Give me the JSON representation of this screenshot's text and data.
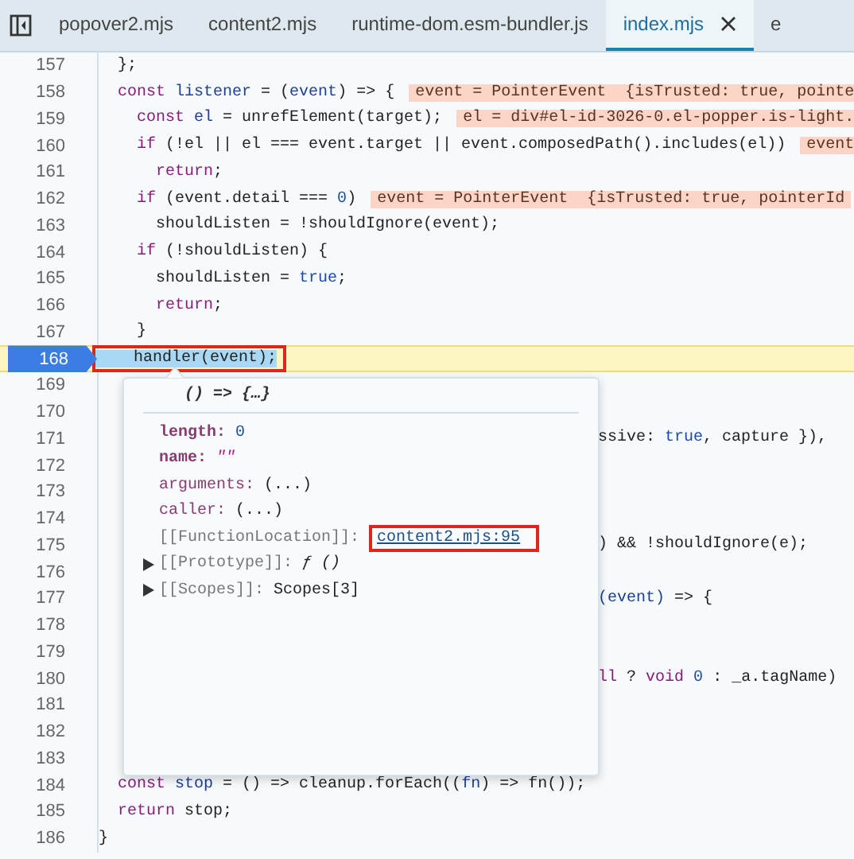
{
  "tabs": [
    {
      "label": "popover2.mjs",
      "selected": false,
      "closable": false
    },
    {
      "label": "content2.mjs",
      "selected": false,
      "closable": false
    },
    {
      "label": "runtime-dom.esm-bundler.js",
      "selected": false,
      "closable": false
    },
    {
      "label": "index.mjs",
      "selected": true,
      "closable": true
    },
    {
      "label": "e",
      "selected": false,
      "closable": false
    }
  ],
  "lines": [
    {
      "number": "157",
      "current": false,
      "marked": false,
      "tokens": [
        {
          "kind": "plain",
          "text": "  };"
        }
      ]
    },
    {
      "number": "158",
      "current": false,
      "marked": false,
      "tokens": [
        {
          "kind": "keyword",
          "text": "  const "
        },
        {
          "kind": "name",
          "text": "listener"
        },
        {
          "kind": "plain",
          "text": " = ("
        },
        {
          "kind": "name",
          "text": "event"
        },
        {
          "kind": "plain",
          "text": ") => {"
        }
      ],
      "inline_value": "event = PointerEvent  {isTrusted: true, pointe"
    },
    {
      "number": "159",
      "current": false,
      "marked": false,
      "tokens": [
        {
          "kind": "keyword",
          "text": "    const "
        },
        {
          "kind": "name",
          "text": "el"
        },
        {
          "kind": "plain",
          "text": " = unrefElement(target);"
        }
      ],
      "inline_value": "el = div#el-id-3026-0.el-popper.is-light."
    },
    {
      "number": "160",
      "current": false,
      "marked": false,
      "tokens": [
        {
          "kind": "keyword",
          "text": "    if"
        },
        {
          "kind": "plain",
          "text": " (!el || el === event.target || event.composedPath().includes(el))"
        }
      ],
      "inline_value": "event"
    },
    {
      "number": "161",
      "current": false,
      "marked": false,
      "tokens": [
        {
          "kind": "keyword",
          "text": "      return"
        },
        {
          "kind": "plain",
          "text": ";"
        }
      ]
    },
    {
      "number": "162",
      "current": false,
      "marked": false,
      "tokens": [
        {
          "kind": "keyword",
          "text": "    if"
        },
        {
          "kind": "plain",
          "text": " (event.detail === "
        },
        {
          "kind": "literal",
          "text": "0"
        },
        {
          "kind": "plain",
          "text": ")"
        }
      ],
      "inline_value": "event = PointerEvent  {isTrusted: true, pointerId"
    },
    {
      "number": "163",
      "current": false,
      "marked": false,
      "tokens": [
        {
          "kind": "plain",
          "text": "      shouldListen = !shouldIgnore(event);"
        }
      ]
    },
    {
      "number": "164",
      "current": false,
      "marked": false,
      "tokens": [
        {
          "kind": "keyword",
          "text": "    if"
        },
        {
          "kind": "plain",
          "text": " (!shouldListen) {"
        }
      ]
    },
    {
      "number": "165",
      "current": false,
      "marked": false,
      "tokens": [
        {
          "kind": "plain",
          "text": "      shouldListen = "
        },
        {
          "kind": "literal",
          "text": "true"
        },
        {
          "kind": "plain",
          "text": ";"
        }
      ]
    },
    {
      "number": "166",
      "current": false,
      "marked": false,
      "tokens": [
        {
          "kind": "keyword",
          "text": "      return"
        },
        {
          "kind": "plain",
          "text": ";"
        }
      ]
    },
    {
      "number": "167",
      "current": false,
      "marked": false,
      "tokens": [
        {
          "kind": "plain",
          "text": "    }"
        }
      ]
    },
    {
      "number": "168",
      "current": true,
      "marked": true,
      "tokens": [
        {
          "kind": "plain",
          "text": "    handler(event);"
        }
      ]
    },
    {
      "number": "169",
      "current": false,
      "marked": false
    },
    {
      "number": "170",
      "current": false,
      "marked": false
    },
    {
      "number": "171",
      "current": false,
      "marked": false,
      "tail": [
        {
          "kind": "plain",
          "text": "ssive: "
        },
        {
          "kind": "literal",
          "text": "true"
        },
        {
          "kind": "plain",
          "text": ", capture }),"
        }
      ]
    },
    {
      "number": "172",
      "current": false,
      "marked": false
    },
    {
      "number": "173",
      "current": false,
      "marked": false
    },
    {
      "number": "174",
      "current": false,
      "marked": false
    },
    {
      "number": "175",
      "current": false,
      "marked": false,
      "tail": [
        {
          "kind": "plain",
          "text": ") && !shouldIgnore(e);"
        }
      ]
    },
    {
      "number": "176",
      "current": false,
      "marked": false
    },
    {
      "number": "177",
      "current": false,
      "marked": false,
      "tail": [
        {
          "kind": "name",
          "text": "(event)"
        },
        {
          "kind": "plain",
          "text": " => {"
        }
      ]
    },
    {
      "number": "178",
      "current": false,
      "marked": false
    },
    {
      "number": "179",
      "current": false,
      "marked": false
    },
    {
      "number": "180",
      "current": false,
      "marked": false,
      "tail": [
        {
          "kind": "keyword",
          "text": "ll"
        },
        {
          "kind": "plain",
          "text": " ? "
        },
        {
          "kind": "keyword",
          "text": "void"
        },
        {
          "kind": "literal",
          "text": " 0"
        },
        {
          "kind": "plain",
          "text": " : _a.tagName)"
        }
      ]
    },
    {
      "number": "181",
      "current": false,
      "marked": false
    },
    {
      "number": "182",
      "current": false,
      "marked": false
    },
    {
      "number": "183",
      "current": false,
      "marked": false
    },
    {
      "number": "184",
      "current": false,
      "marked": false,
      "tokens": [
        {
          "kind": "keyword",
          "text": "  const "
        },
        {
          "kind": "name",
          "text": "stop"
        },
        {
          "kind": "plain",
          "text": " = () => cleanup.forEach(("
        },
        {
          "kind": "name",
          "text": "fn"
        },
        {
          "kind": "plain",
          "text": ") => fn());"
        }
      ]
    },
    {
      "number": "185",
      "current": false,
      "marked": false,
      "tokens": [
        {
          "kind": "keyword",
          "text": "  return"
        },
        {
          "kind": "plain",
          "text": " stop;"
        }
      ]
    },
    {
      "number": "186",
      "current": false,
      "marked": false,
      "tokens": [
        {
          "kind": "plain",
          "text": "}"
        }
      ]
    }
  ],
  "popover": {
    "title": "() => {…}",
    "properties": [
      {
        "name": {
          "kind": "own",
          "text": "length:"
        },
        "value": {
          "kind": "number",
          "text": "0"
        },
        "expandable": false,
        "marked": false
      },
      {
        "name": {
          "kind": "own",
          "text": "name:"
        },
        "value": {
          "kind": "string",
          "text": "\"\""
        },
        "expandable": false,
        "marked": false
      },
      {
        "name": {
          "kind": "accessor",
          "text": "arguments:"
        },
        "value": {
          "kind": "plain",
          "text": "(...)"
        },
        "expandable": false,
        "marked": false
      },
      {
        "name": {
          "kind": "accessor",
          "text": "caller:"
        },
        "value": {
          "kind": "plain",
          "text": "(...)"
        },
        "expandable": false,
        "marked": false
      },
      {
        "name": {
          "kind": "internal",
          "text": "[[FunctionLocation]]:"
        },
        "value": {
          "kind": "link",
          "text": "content2.mjs:95"
        },
        "expandable": false,
        "marked": true
      },
      {
        "name": {
          "kind": "internal",
          "text": "[[Prototype]]:"
        },
        "value": {
          "kind": "function",
          "text": "ƒ ()"
        },
        "expandable": true,
        "marked": false
      },
      {
        "name": {
          "kind": "internal",
          "text": "[[Scopes]]:"
        },
        "value": {
          "kind": "plain",
          "text": "Scopes[3]"
        },
        "expandable": true,
        "marked": false
      }
    ]
  }
}
